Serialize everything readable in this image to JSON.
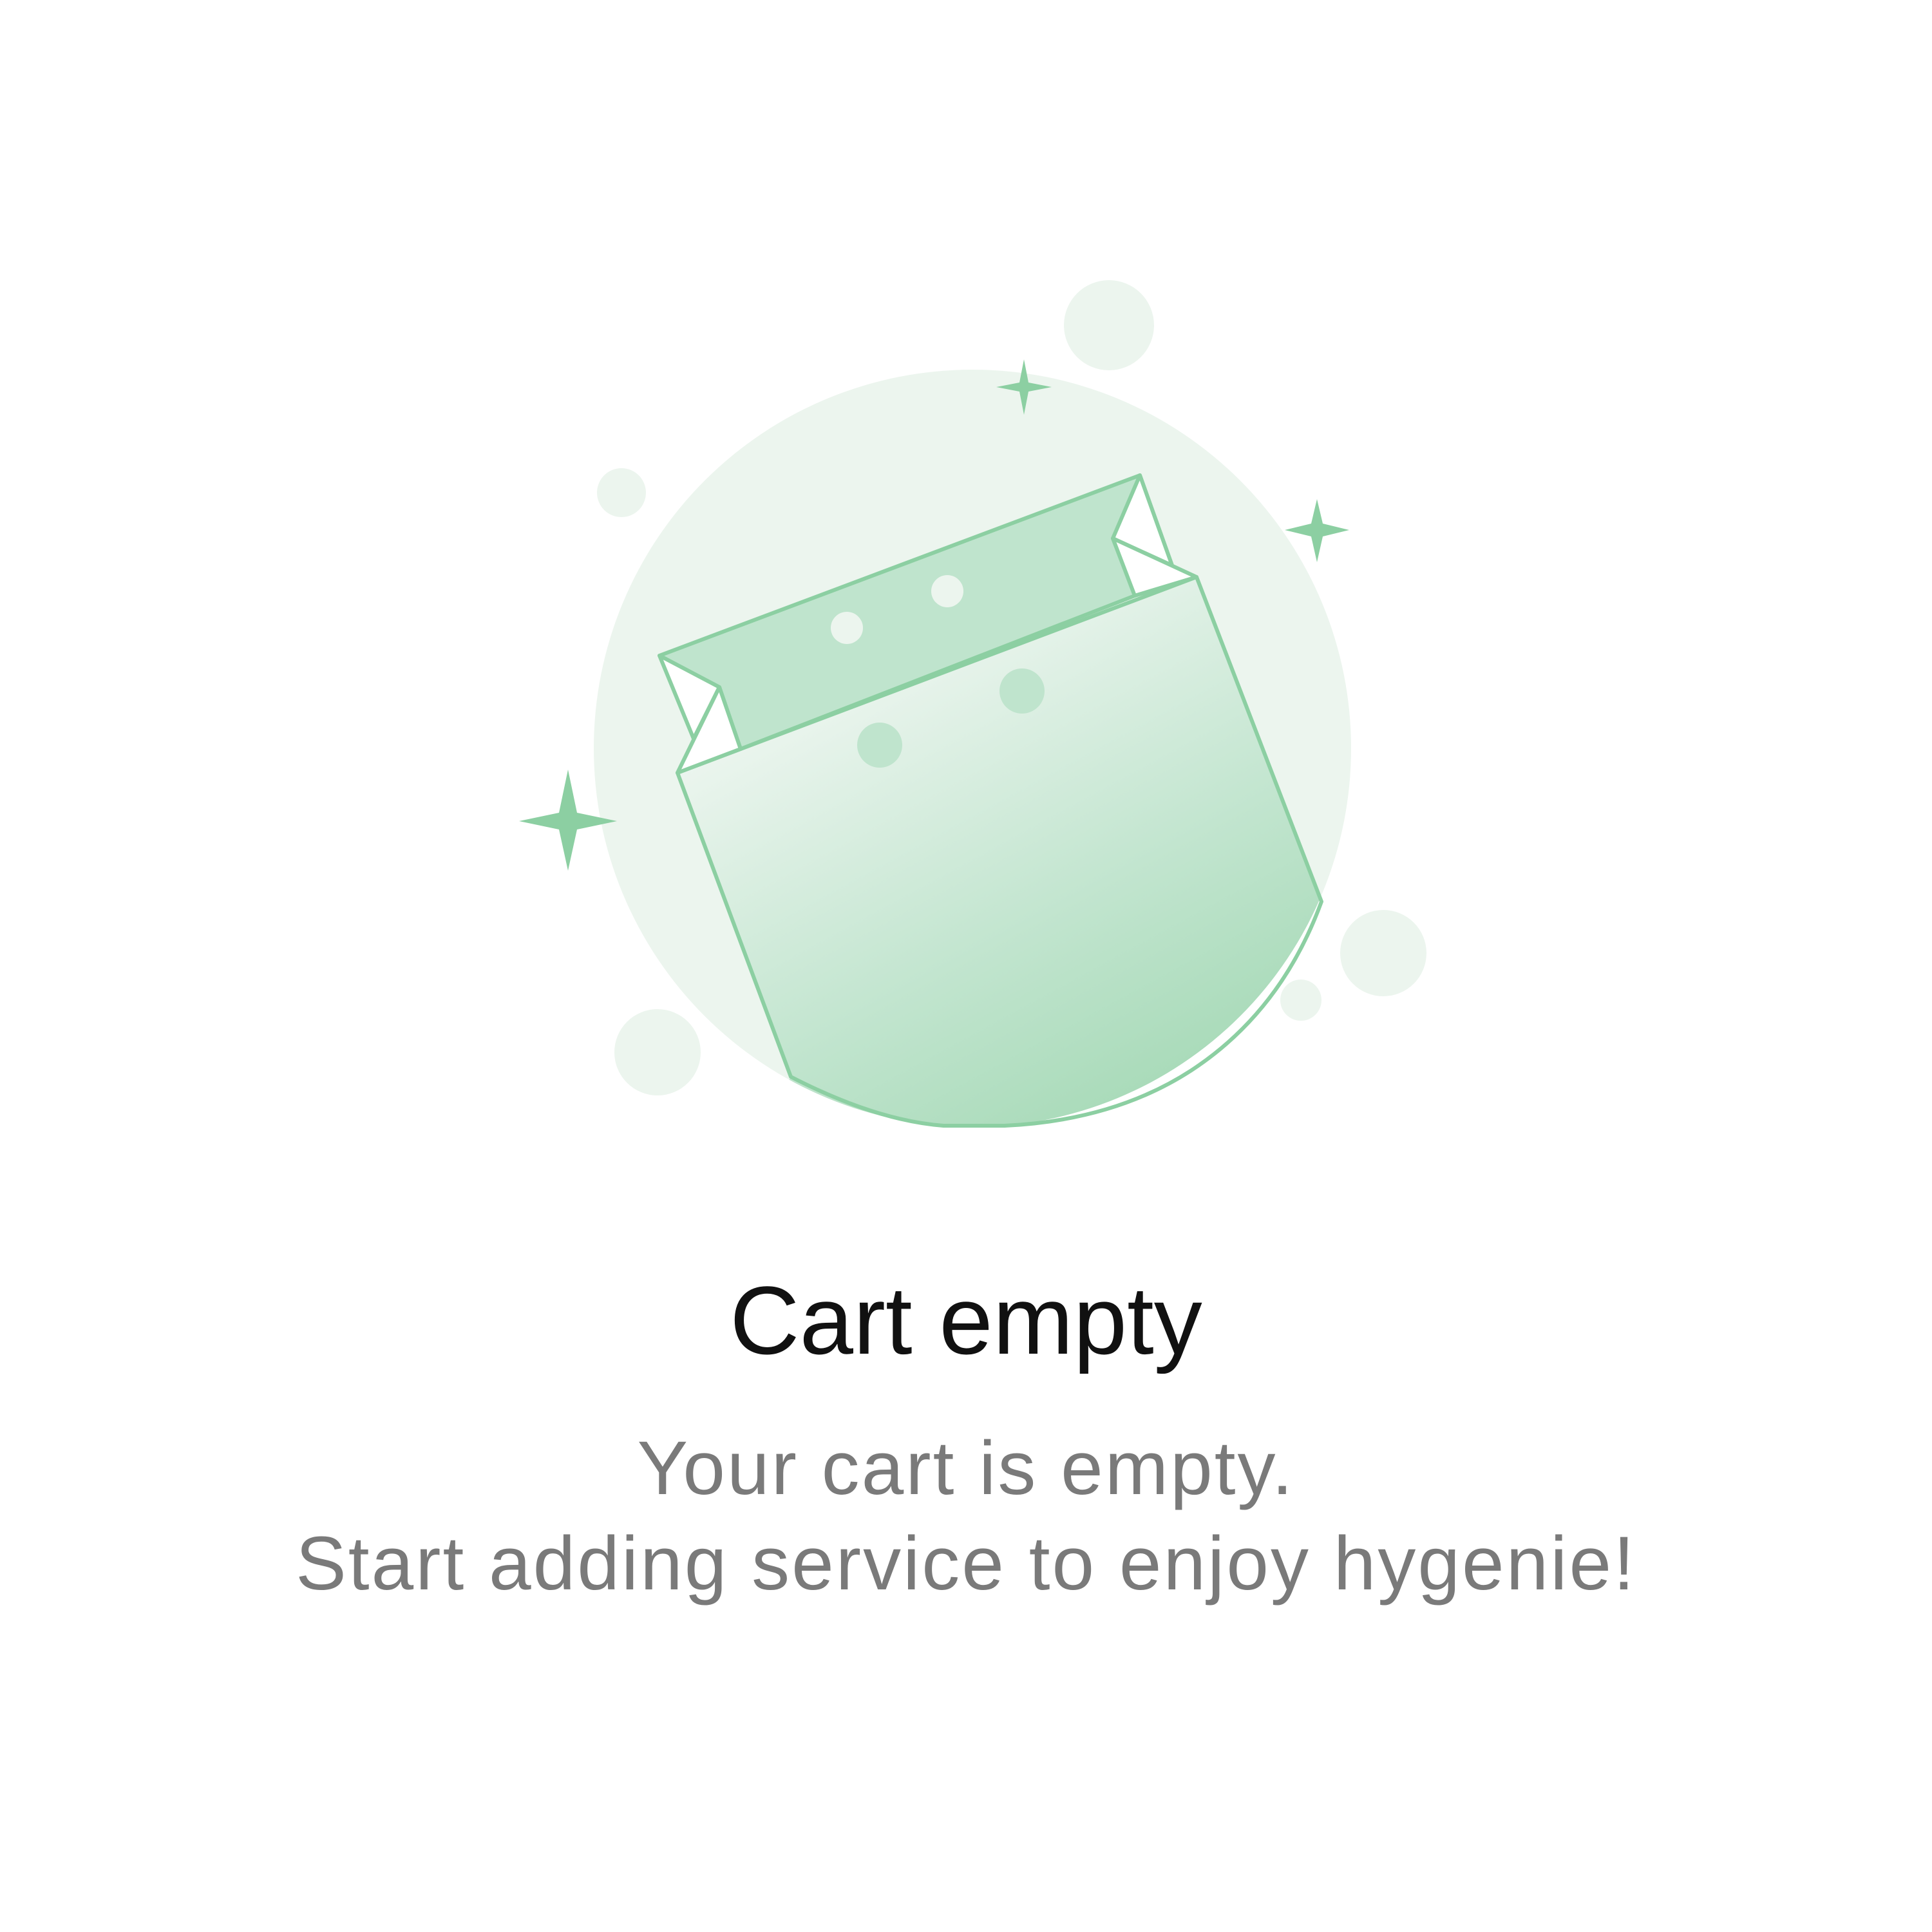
{
  "empty_state": {
    "title": "Cart empty",
    "message_line1": "Your cart is empty.",
    "message_line2": "Start adding service to enjoy hygenie!"
  },
  "colors": {
    "accent_green": "#8ccfa2",
    "pale_green": "#ecf5ee",
    "light_green_fill": "#bfe4cd",
    "title_color": "#111111",
    "message_color": "#7a7a7a",
    "background": "#ffffff"
  },
  "illustration": {
    "icon": "empty-cart-bag-icon"
  }
}
